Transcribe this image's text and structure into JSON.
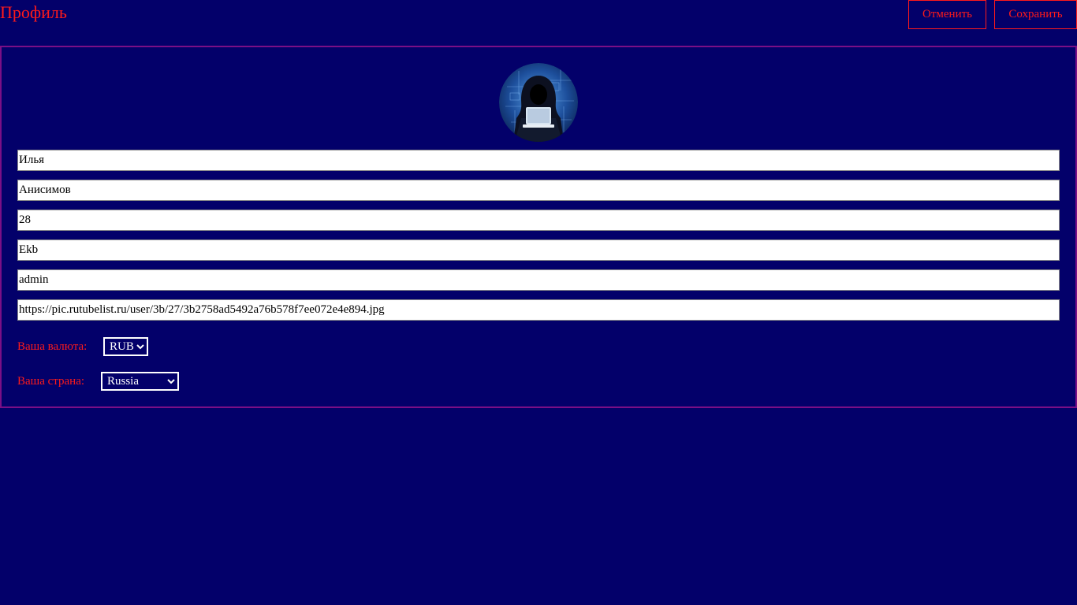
{
  "header": {
    "title": "Профиль",
    "cancel_label": "Отменить",
    "save_label": "Сохранить"
  },
  "profile": {
    "first_name": "Илья",
    "last_name": "Анисимов",
    "age": "28",
    "city": "Ekb",
    "role": "admin",
    "avatar_url": "https://pic.rutubelist.ru/user/3b/27/3b2758ad5492a76b578f7ee072e4e894.jpg"
  },
  "currency": {
    "label": "Ваша валюта:",
    "selected": "RUB"
  },
  "country": {
    "label": "Ваша страна:",
    "selected": "Russia"
  },
  "colors": {
    "background": "#03006a",
    "accent": "#ff1a1a",
    "card_border": "#7a0f86"
  },
  "icons": {
    "avatar": "hooded-hacker-avatar"
  }
}
